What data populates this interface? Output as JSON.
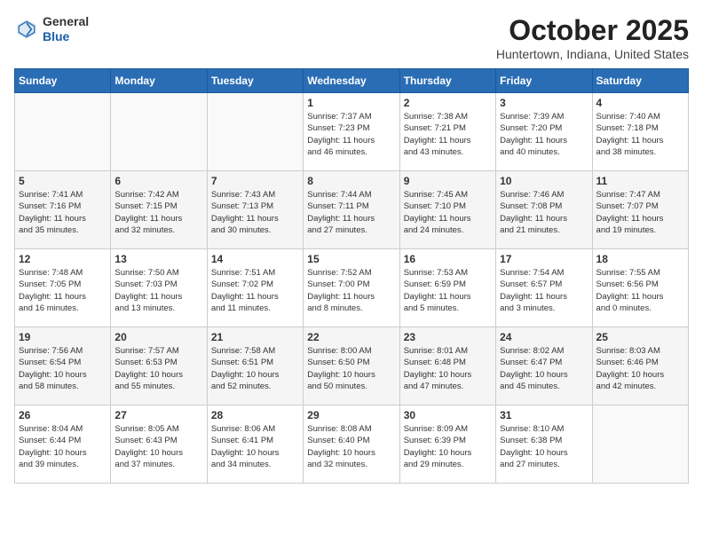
{
  "header": {
    "logo_general": "General",
    "logo_blue": "Blue",
    "month": "October 2025",
    "location": "Huntertown, Indiana, United States"
  },
  "days_of_week": [
    "Sunday",
    "Monday",
    "Tuesday",
    "Wednesday",
    "Thursday",
    "Friday",
    "Saturday"
  ],
  "weeks": [
    [
      {
        "day": "",
        "info": ""
      },
      {
        "day": "",
        "info": ""
      },
      {
        "day": "",
        "info": ""
      },
      {
        "day": "1",
        "info": "Sunrise: 7:37 AM\nSunset: 7:23 PM\nDaylight: 11 hours\nand 46 minutes."
      },
      {
        "day": "2",
        "info": "Sunrise: 7:38 AM\nSunset: 7:21 PM\nDaylight: 11 hours\nand 43 minutes."
      },
      {
        "day": "3",
        "info": "Sunrise: 7:39 AM\nSunset: 7:20 PM\nDaylight: 11 hours\nand 40 minutes."
      },
      {
        "day": "4",
        "info": "Sunrise: 7:40 AM\nSunset: 7:18 PM\nDaylight: 11 hours\nand 38 minutes."
      }
    ],
    [
      {
        "day": "5",
        "info": "Sunrise: 7:41 AM\nSunset: 7:16 PM\nDaylight: 11 hours\nand 35 minutes."
      },
      {
        "day": "6",
        "info": "Sunrise: 7:42 AM\nSunset: 7:15 PM\nDaylight: 11 hours\nand 32 minutes."
      },
      {
        "day": "7",
        "info": "Sunrise: 7:43 AM\nSunset: 7:13 PM\nDaylight: 11 hours\nand 30 minutes."
      },
      {
        "day": "8",
        "info": "Sunrise: 7:44 AM\nSunset: 7:11 PM\nDaylight: 11 hours\nand 27 minutes."
      },
      {
        "day": "9",
        "info": "Sunrise: 7:45 AM\nSunset: 7:10 PM\nDaylight: 11 hours\nand 24 minutes."
      },
      {
        "day": "10",
        "info": "Sunrise: 7:46 AM\nSunset: 7:08 PM\nDaylight: 11 hours\nand 21 minutes."
      },
      {
        "day": "11",
        "info": "Sunrise: 7:47 AM\nSunset: 7:07 PM\nDaylight: 11 hours\nand 19 minutes."
      }
    ],
    [
      {
        "day": "12",
        "info": "Sunrise: 7:48 AM\nSunset: 7:05 PM\nDaylight: 11 hours\nand 16 minutes."
      },
      {
        "day": "13",
        "info": "Sunrise: 7:50 AM\nSunset: 7:03 PM\nDaylight: 11 hours\nand 13 minutes."
      },
      {
        "day": "14",
        "info": "Sunrise: 7:51 AM\nSunset: 7:02 PM\nDaylight: 11 hours\nand 11 minutes."
      },
      {
        "day": "15",
        "info": "Sunrise: 7:52 AM\nSunset: 7:00 PM\nDaylight: 11 hours\nand 8 minutes."
      },
      {
        "day": "16",
        "info": "Sunrise: 7:53 AM\nSunset: 6:59 PM\nDaylight: 11 hours\nand 5 minutes."
      },
      {
        "day": "17",
        "info": "Sunrise: 7:54 AM\nSunset: 6:57 PM\nDaylight: 11 hours\nand 3 minutes."
      },
      {
        "day": "18",
        "info": "Sunrise: 7:55 AM\nSunset: 6:56 PM\nDaylight: 11 hours\nand 0 minutes."
      }
    ],
    [
      {
        "day": "19",
        "info": "Sunrise: 7:56 AM\nSunset: 6:54 PM\nDaylight: 10 hours\nand 58 minutes."
      },
      {
        "day": "20",
        "info": "Sunrise: 7:57 AM\nSunset: 6:53 PM\nDaylight: 10 hours\nand 55 minutes."
      },
      {
        "day": "21",
        "info": "Sunrise: 7:58 AM\nSunset: 6:51 PM\nDaylight: 10 hours\nand 52 minutes."
      },
      {
        "day": "22",
        "info": "Sunrise: 8:00 AM\nSunset: 6:50 PM\nDaylight: 10 hours\nand 50 minutes."
      },
      {
        "day": "23",
        "info": "Sunrise: 8:01 AM\nSunset: 6:48 PM\nDaylight: 10 hours\nand 47 minutes."
      },
      {
        "day": "24",
        "info": "Sunrise: 8:02 AM\nSunset: 6:47 PM\nDaylight: 10 hours\nand 45 minutes."
      },
      {
        "day": "25",
        "info": "Sunrise: 8:03 AM\nSunset: 6:46 PM\nDaylight: 10 hours\nand 42 minutes."
      }
    ],
    [
      {
        "day": "26",
        "info": "Sunrise: 8:04 AM\nSunset: 6:44 PM\nDaylight: 10 hours\nand 39 minutes."
      },
      {
        "day": "27",
        "info": "Sunrise: 8:05 AM\nSunset: 6:43 PM\nDaylight: 10 hours\nand 37 minutes."
      },
      {
        "day": "28",
        "info": "Sunrise: 8:06 AM\nSunset: 6:41 PM\nDaylight: 10 hours\nand 34 minutes."
      },
      {
        "day": "29",
        "info": "Sunrise: 8:08 AM\nSunset: 6:40 PM\nDaylight: 10 hours\nand 32 minutes."
      },
      {
        "day": "30",
        "info": "Sunrise: 8:09 AM\nSunset: 6:39 PM\nDaylight: 10 hours\nand 29 minutes."
      },
      {
        "day": "31",
        "info": "Sunrise: 8:10 AM\nSunset: 6:38 PM\nDaylight: 10 hours\nand 27 minutes."
      },
      {
        "day": "",
        "info": ""
      }
    ]
  ]
}
